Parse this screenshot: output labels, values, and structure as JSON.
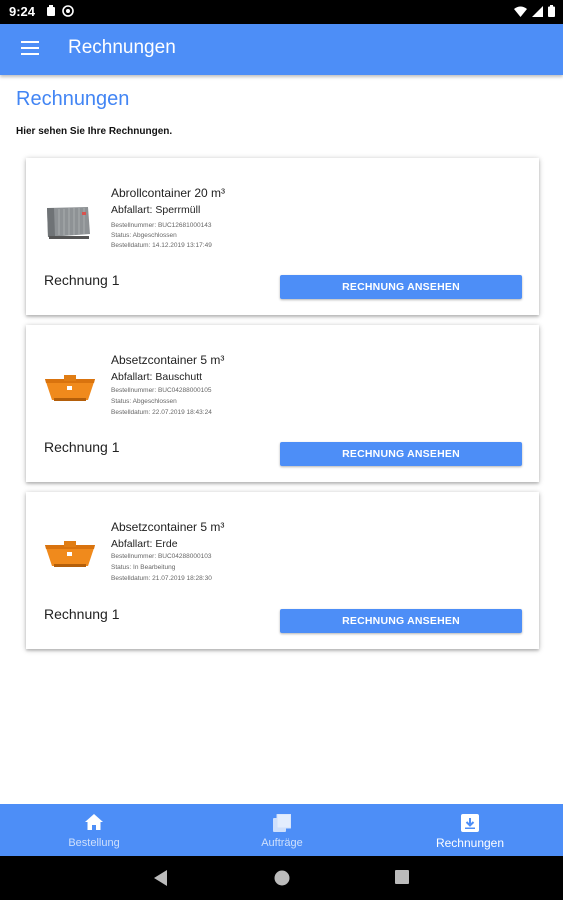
{
  "status_bar": {
    "time": "9:24"
  },
  "app_bar": {
    "title": "Rechnungen"
  },
  "page": {
    "title": "Rechnungen",
    "subtitle": "Hier sehen Sie Ihre Rechnungen."
  },
  "cards": [
    {
      "name": "Abrollcontainer 20 m³",
      "waste": "Abfallart: Sperrmüll",
      "order_no": "Bestellnummer: BUC12681000143",
      "status": "Status: Abgeschlossen",
      "date": "Bestelldatum: 14.12.2019 13:17:49",
      "invoice": "Rechnung 1",
      "button": "RECHNUNG ANSEHEN",
      "image": "roll-off-container"
    },
    {
      "name": "Absetzcontainer 5 m³",
      "waste": "Abfallart: Bauschutt",
      "order_no": "Bestellnummer: BUC04288000105",
      "status": "Status: Abgeschlossen",
      "date": "Bestelldatum: 22.07.2019 18:43:24",
      "invoice": "Rechnung 1",
      "button": "RECHNUNG ANSEHEN",
      "image": "skip-container"
    },
    {
      "name": "Absetzcontainer 5 m³",
      "waste": "Abfallart: Erde",
      "order_no": "Bestellnummer: BUC04288000103",
      "status": "Status: In Bearbeitung",
      "date": "Bestelldatum: 21.07.2019 18:28:30",
      "invoice": "Rechnung 1",
      "button": "RECHNUNG ANSEHEN",
      "image": "skip-container"
    }
  ],
  "bottom_nav": [
    {
      "label": "Bestellung",
      "icon": "home-icon",
      "active": false
    },
    {
      "label": "Aufträge",
      "icon": "orders-icon",
      "active": false
    },
    {
      "label": "Rechnungen",
      "icon": "invoice-icon",
      "active": true
    }
  ],
  "colors": {
    "primary": "#4d8ef7",
    "title": "#4285f4",
    "container_orange": "#f08a1c"
  }
}
